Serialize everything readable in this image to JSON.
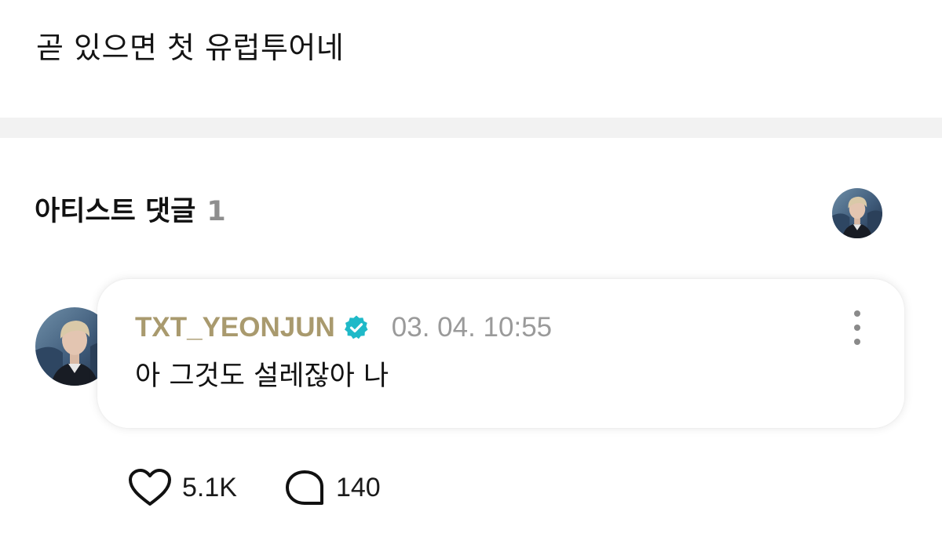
{
  "post": {
    "text": "곧 있으면 첫 유럽투어네"
  },
  "artist_comments": {
    "title": "아티스트 댓글",
    "count": "1",
    "header_avatar_icon": "artist-profile-avatar"
  },
  "comment": {
    "author": "TXT_YEONJUN",
    "verified_icon": "verified-badge-icon",
    "timestamp": "03. 04. 10:55",
    "text": "아 그것도 설레잖아 나",
    "more_icon": "more-vertical-icon",
    "likes": "5.1K",
    "replies": "140",
    "like_icon": "heart-icon",
    "reply_icon": "comment-bubble-icon"
  },
  "colors": {
    "author_name": "#a99a6e",
    "verified_badge": "#1fb9c8",
    "timestamp": "#9a9a9a",
    "count": "#8e8e8e",
    "divider": "#f2f2f2"
  }
}
